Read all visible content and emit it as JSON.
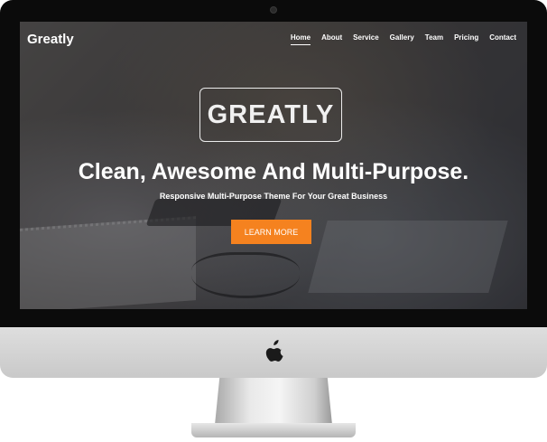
{
  "site": {
    "logo": "Greatly",
    "nav": [
      "Home",
      "About",
      "Service",
      "Gallery",
      "Team",
      "Pricing",
      "Contact"
    ],
    "active_nav": "Home"
  },
  "hero": {
    "brand": "GREATLY",
    "headline": "Clean, Awesome And Multi-Purpose.",
    "subheadline": "Responsive Multi-Purpose Theme For Your Great Business",
    "cta_label": "LEARN MORE"
  },
  "colors": {
    "accent": "#f5821f",
    "bezel": "#0b0b0b",
    "chin": "#d4d4d4"
  },
  "icons": {
    "chin_logo": "apple-logo-icon"
  }
}
